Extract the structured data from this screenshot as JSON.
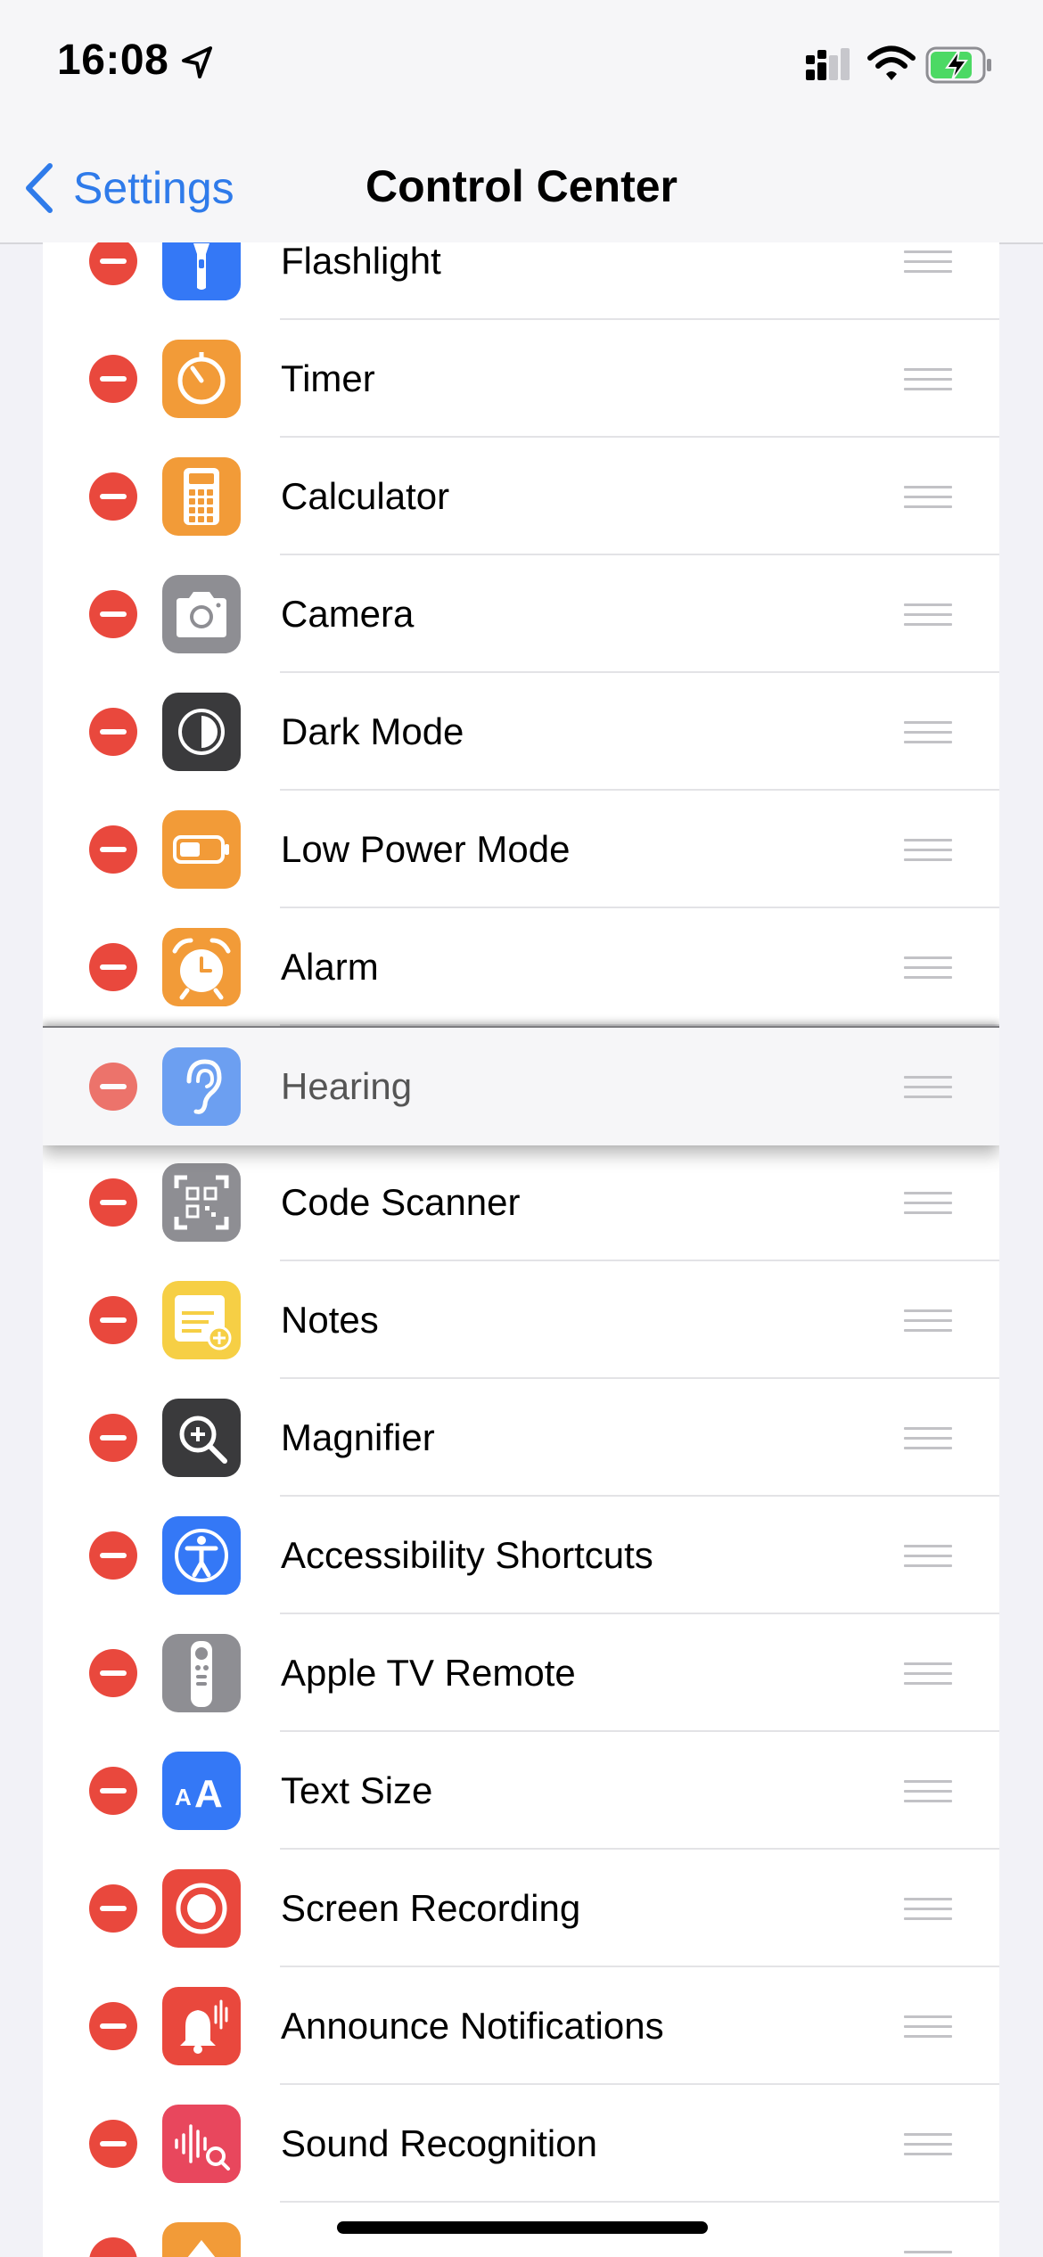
{
  "status_bar": {
    "time": "16:08"
  },
  "nav": {
    "back_label": "Settings",
    "title": "Control Center"
  },
  "controls": [
    {
      "label": "Flashlight",
      "icon": "flashlight-icon",
      "color": "#3478f6"
    },
    {
      "label": "Timer",
      "icon": "timer-icon",
      "color": "#f29b38"
    },
    {
      "label": "Calculator",
      "icon": "calculator-icon",
      "color": "#f29b38"
    },
    {
      "label": "Camera",
      "icon": "camera-icon",
      "color": "#8e8e93"
    },
    {
      "label": "Dark Mode",
      "icon": "dark-mode-icon",
      "color": "#3a3a3c"
    },
    {
      "label": "Low Power Mode",
      "icon": "battery-icon",
      "color": "#f29b38"
    },
    {
      "label": "Alarm",
      "icon": "alarm-icon",
      "color": "#f29b38"
    },
    {
      "label": "Hearing",
      "icon": "ear-icon",
      "color": "#5591f0",
      "dragging": true
    },
    {
      "label": "Code Scanner",
      "icon": "qr-code-icon",
      "color": "#8e8e93"
    },
    {
      "label": "Notes",
      "icon": "notes-icon",
      "color": "#f6cf45"
    },
    {
      "label": "Magnifier",
      "icon": "magnifier-icon",
      "color": "#3a3a3c"
    },
    {
      "label": "Accessibility Shortcuts",
      "icon": "accessibility-icon",
      "color": "#3478f6"
    },
    {
      "label": "Apple TV Remote",
      "icon": "tv-remote-icon",
      "color": "#8e8e93"
    },
    {
      "label": "Text Size",
      "icon": "text-size-icon",
      "color": "#3478f6"
    },
    {
      "label": "Screen Recording",
      "icon": "screen-recording-icon",
      "color": "#e9483d"
    },
    {
      "label": "Announce Notifications",
      "icon": "announce-notifications-icon",
      "color": "#e9483d"
    },
    {
      "label": "Sound Recognition",
      "icon": "sound-recognition-icon",
      "color": "#e8475d"
    },
    {
      "label": "",
      "icon": "partial-icon",
      "color": "#f29b38"
    }
  ]
}
